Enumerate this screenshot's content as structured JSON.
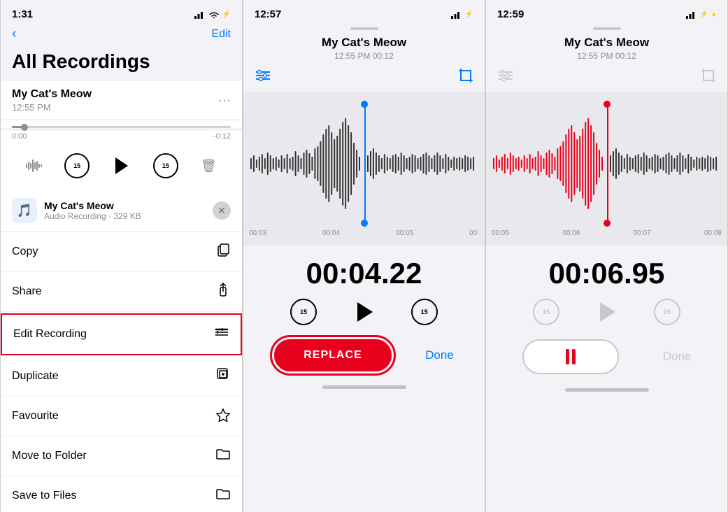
{
  "phone1": {
    "status_time": "1:31",
    "nav_back": "‹",
    "nav_edit": "Edit",
    "page_title": "All Recordings",
    "recording": {
      "name": "My Cat's Meow",
      "time": "12:55 PM",
      "progress_start": "0:00",
      "progress_end": "-0:12"
    },
    "context_menu": {
      "file_name": "My Cat's Meow",
      "file_type": "Audio Recording · 329 KB",
      "items": [
        {
          "label": "Copy",
          "icon": "📋"
        },
        {
          "label": "Share",
          "icon": "↑"
        },
        {
          "label": "Edit Recording",
          "icon": "≋",
          "highlighted": true
        },
        {
          "label": "Duplicate",
          "icon": "⊞"
        },
        {
          "label": "Favourite",
          "icon": "♡"
        },
        {
          "label": "Move to Folder",
          "icon": "🗂"
        },
        {
          "label": "Save to Files",
          "icon": "📁"
        }
      ]
    }
  },
  "phone2": {
    "status_time": "12:57",
    "title": "My Cat's Meow",
    "subtitle": "12:55 PM  00:12",
    "timestamp": "00:04.22",
    "time_markers": [
      "00:03",
      "00:04",
      "00:05",
      "00:"
    ],
    "replace_label": "REPLACE",
    "done_label": "Done"
  },
  "phone3": {
    "status_time": "12:59",
    "title": "My Cat's Meow",
    "subtitle": "12:55 PM  00:12",
    "timestamp": "00:06.95",
    "time_markers": [
      "00:05",
      "00:06",
      "00:07",
      "00:08"
    ],
    "done_label": "Done"
  }
}
